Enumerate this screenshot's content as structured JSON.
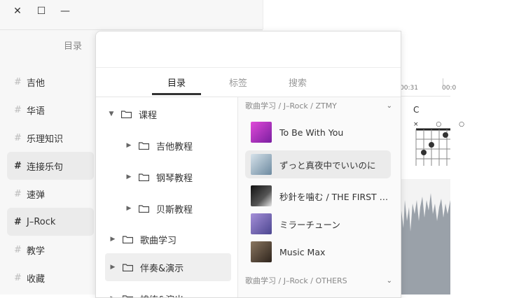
{
  "window_controls": {
    "close": "✕",
    "maximize": "☐",
    "minimize": "—"
  },
  "sidebar": {
    "title": "目录",
    "items": [
      {
        "label": "吉他",
        "active": false
      },
      {
        "label": "华语",
        "active": false
      },
      {
        "label": "乐理知识",
        "active": false
      },
      {
        "label": "连接乐句",
        "active": true
      },
      {
        "label": "速弹",
        "active": false
      },
      {
        "label": "J–Rock",
        "active": true
      },
      {
        "label": "教学",
        "active": false
      },
      {
        "label": "收藏",
        "active": false
      }
    ]
  },
  "timeline": {
    "ticks": [
      "00:31",
      "00:0"
    ]
  },
  "chord": {
    "name": "C",
    "markers": "× ○ ○"
  },
  "panel": {
    "tabs": [
      {
        "label": "目录",
        "active": true
      },
      {
        "label": "标签",
        "active": false
      },
      {
        "label": "搜索",
        "active": false
      }
    ],
    "tree": [
      {
        "label": "课程",
        "expanded": true,
        "level": 0,
        "selected": false
      },
      {
        "label": "吉他教程",
        "expanded": false,
        "level": 1,
        "selected": false
      },
      {
        "label": "钢琴教程",
        "expanded": false,
        "level": 1,
        "selected": false
      },
      {
        "label": "贝斯教程",
        "expanded": false,
        "level": 1,
        "selected": false
      },
      {
        "label": "歌曲学习",
        "expanded": false,
        "level": 0,
        "selected": false
      },
      {
        "label": "伴奏&演示",
        "expanded": false,
        "level": 0,
        "selected": true
      },
      {
        "label": "排练&演出",
        "expanded": false,
        "level": 0,
        "selected": false
      }
    ],
    "groups": [
      {
        "path": "歌曲学习 / J–Rock / ZTMY",
        "songs": [
          {
            "title": "To Be With You",
            "selected": false,
            "thumb_color": "#c64bd6"
          },
          {
            "title": "ずっと真夜中でいいのに",
            "selected": true,
            "thumb_color": "#9fb7c6"
          },
          {
            "title": "秒針を噛む / THE FIRST TAKE",
            "selected": false,
            "thumb_color": "#2a2a2a"
          },
          {
            "title": "ミラーチューン",
            "selected": false,
            "thumb_color": "#7a6fb3"
          },
          {
            "title": "Music Max",
            "selected": false,
            "thumb_color": "#5a4a3a"
          }
        ]
      },
      {
        "path": "歌曲学习 / J–Rock / OTHERS",
        "songs": []
      }
    ]
  }
}
